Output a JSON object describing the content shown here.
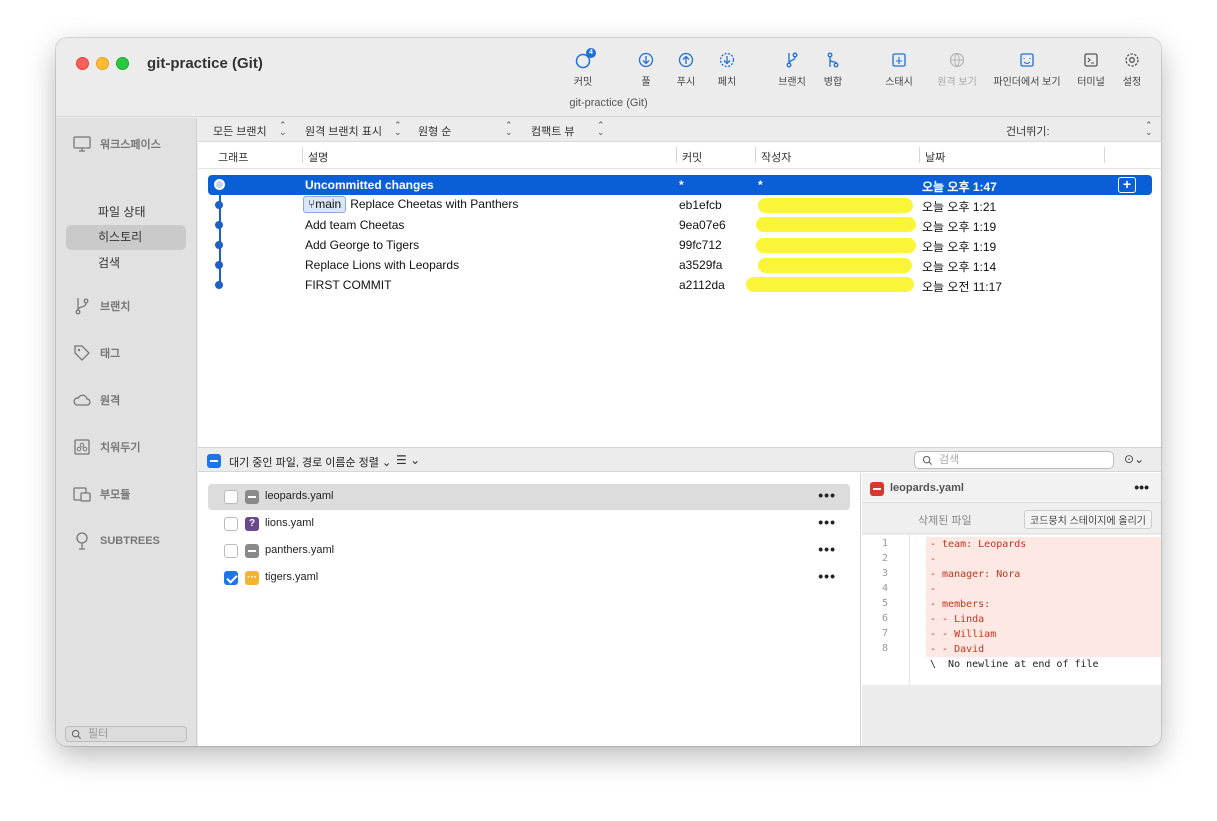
{
  "window": {
    "title": "git-practice (Git)",
    "subtitle": "git-practice (Git)"
  },
  "toolbar": {
    "commit": "커밋",
    "commit_badge": "4",
    "pull": "풀",
    "push": "푸시",
    "fetch": "페치",
    "branch": "브랜치",
    "merge": "병합",
    "stash": "스태시",
    "remote_view": "원격 보기",
    "finder": "파인더에서 보기",
    "terminal": "터미널",
    "settings": "설정"
  },
  "sidebar": {
    "workspace": "워크스페이스",
    "file_status": "파일 상태",
    "history": "히스토리",
    "search": "검색",
    "branches": "브랜치",
    "tags": "태그",
    "remotes": "원격",
    "stashes": "치워두기",
    "submodules": "부모듈",
    "subtrees": "SUBTREES",
    "filter_placeholder": "필터"
  },
  "filterbar": {
    "all_branches": "모든 브랜치",
    "show_remote": "원격 브랜치 표시",
    "order": "원형 순",
    "compact": "컴팩트 뷰",
    "jump_to": "건너뛰기:"
  },
  "columns": {
    "graph": "그래프",
    "description": "설명",
    "commit": "커밋",
    "author": "작성자",
    "date": "날짜"
  },
  "commits": [
    {
      "description": "Uncommitted changes",
      "branch": "",
      "hash": "*",
      "author": "*",
      "date": "오늘 오후 1:47"
    },
    {
      "description": "Replace Cheetas with Panthers",
      "branch": "main",
      "hash": "eb1efcb",
      "author": "",
      "date": "오늘 오후 1:21"
    },
    {
      "description": "Add team Cheetas",
      "branch": "",
      "hash": "9ea07e6",
      "author": "",
      "date": "오늘 오후 1:19"
    },
    {
      "description": "Add George to Tigers",
      "branch": "",
      "hash": "99fc712",
      "author": "",
      "date": "오늘 오후 1:19"
    },
    {
      "description": "Replace Lions with Leopards",
      "branch": "",
      "hash": "a3529fa",
      "author": "",
      "date": "오늘 오후 1:14"
    },
    {
      "description": "FIRST COMMIT",
      "branch": "",
      "hash": "a2112da",
      "author": "",
      "date": "오늘 오전 11:17"
    }
  ],
  "pending": {
    "label": "대기 중인 파일, 경로 이름순 정렬",
    "search_placeholder": "검색",
    "files": [
      {
        "name": "leopards.yaml",
        "status": "removed",
        "checked": false
      },
      {
        "name": "lions.yaml",
        "status": "untracked",
        "checked": false
      },
      {
        "name": "panthers.yaml",
        "status": "removed",
        "checked": false
      },
      {
        "name": "tigers.yaml",
        "status": "modified",
        "checked": true
      }
    ]
  },
  "diff": {
    "file": "leopards.yaml",
    "hunk_label": "삭제된 파일",
    "stage_hunk": "코드뭉치 스테이지에 올리기",
    "lines": [
      {
        "num": "1",
        "text": "- team: Leopards"
      },
      {
        "num": "2",
        "text": "-"
      },
      {
        "num": "3",
        "text": "- manager: Nora"
      },
      {
        "num": "4",
        "text": "-"
      },
      {
        "num": "5",
        "text": "- members:"
      },
      {
        "num": "6",
        "text": "- - Linda"
      },
      {
        "num": "7",
        "text": "- - William"
      },
      {
        "num": "8",
        "text": "- - David"
      }
    ],
    "no_newline": "\\  No newline at end of file"
  },
  "colors": {
    "accent": "#0a5fd6",
    "graph": "#1e60c7",
    "removed_line_bg": "#fde8e4",
    "redaction": "#fbf53a"
  }
}
